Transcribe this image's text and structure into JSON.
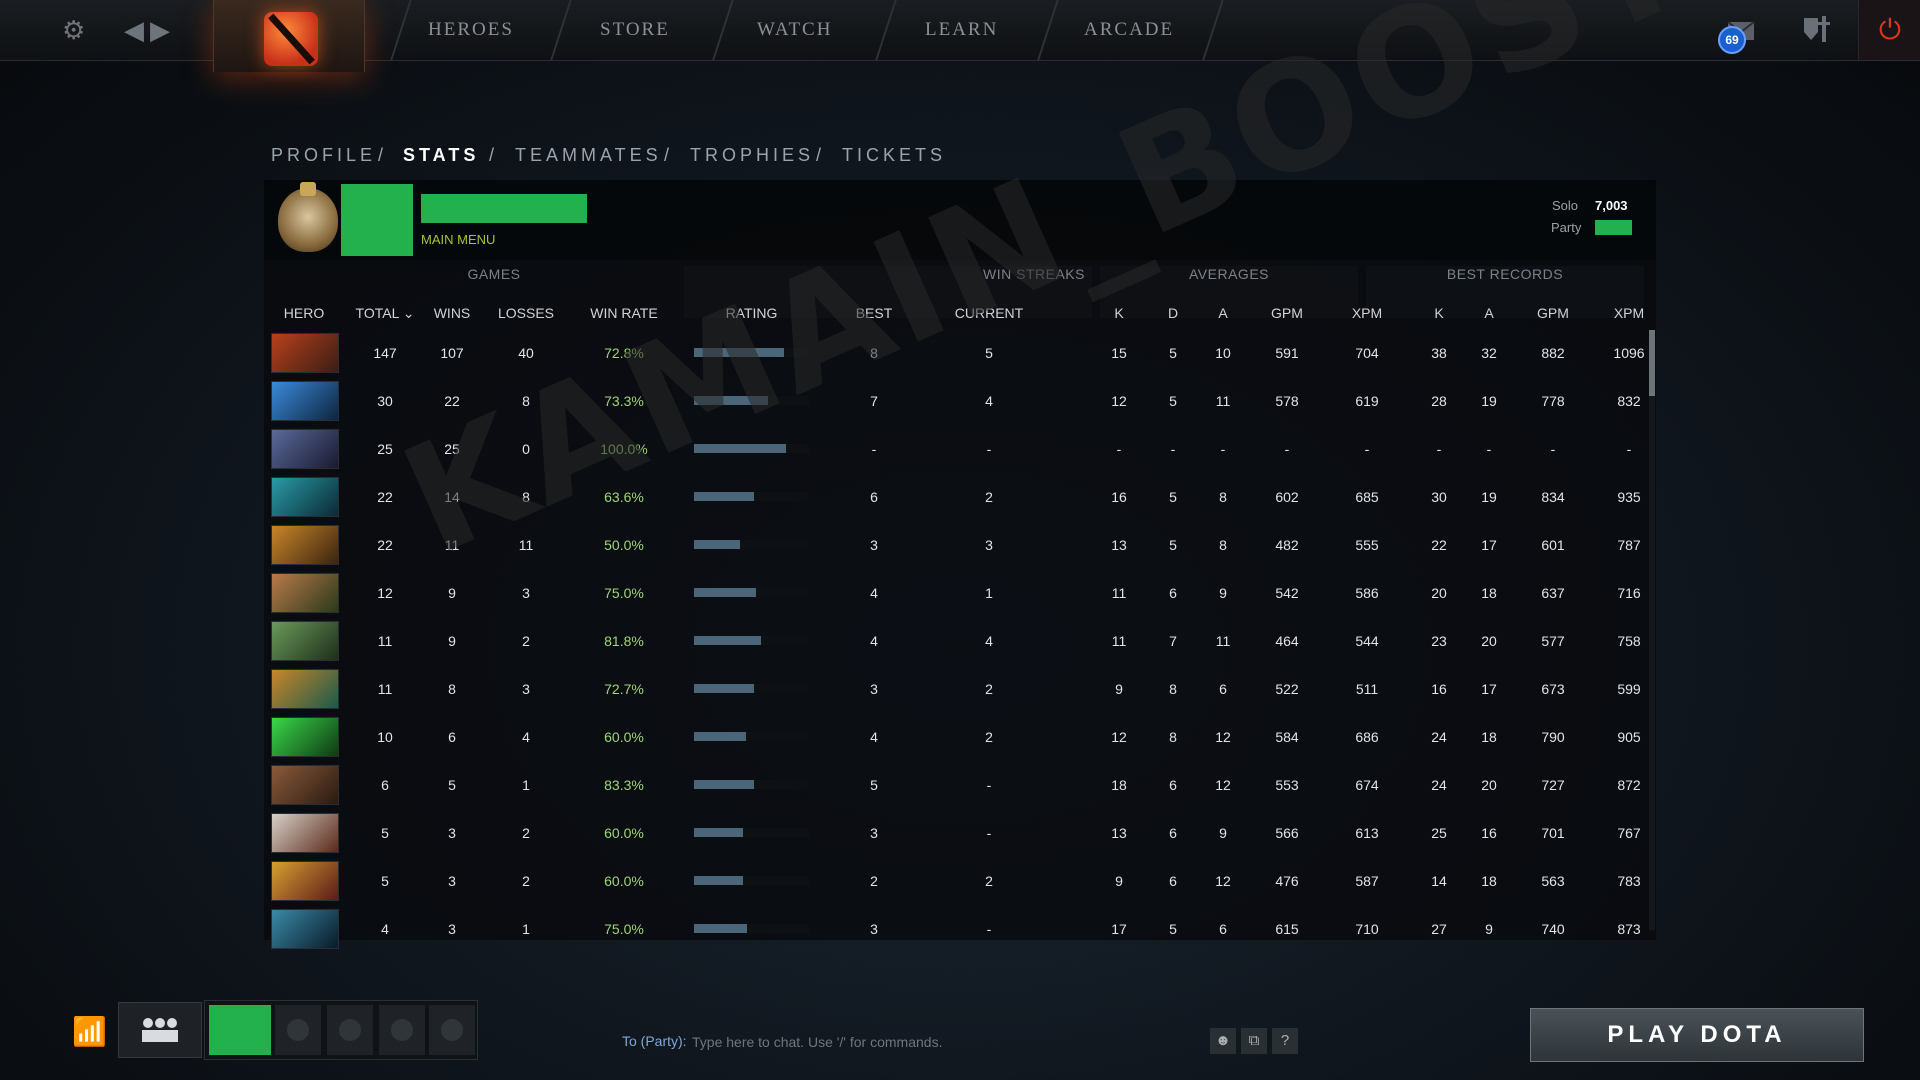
{
  "topbar": {
    "nav": [
      "HEROES",
      "STORE",
      "WATCH",
      "LEARN",
      "ARCADE"
    ],
    "notification_count": "69"
  },
  "profile_tabs": [
    "PROFILE",
    "STATS",
    "TEAMMATES",
    "TROPHIES",
    "TICKETS"
  ],
  "header": {
    "status": "MAIN MENU",
    "solo_label": "Solo",
    "solo_value": "7,003",
    "party_label": "Party"
  },
  "groups": {
    "games": "GAMES",
    "win_streaks": "WIN STREAKS",
    "averages": "AVERAGES",
    "best_records": "BEST RECORDS"
  },
  "columns": {
    "hero": "HERO",
    "total": "TOTAL ⌄",
    "wins": "WINS",
    "losses": "LOSSES",
    "win_rate": "WIN RATE",
    "rating": "RATING",
    "best": "BEST",
    "current": "CURRENT",
    "avg_k": "K",
    "avg_d": "D",
    "avg_a": "A",
    "avg_gpm": "GPM",
    "avg_xpm": "XPM",
    "best_k": "K",
    "best_a": "A",
    "best_gpm": "GPM",
    "best_xpm": "XPM"
  },
  "rows": [
    {
      "colors": [
        "#b8401c",
        "#3a1e14"
      ],
      "total": "147",
      "wins": "107",
      "losses": "40",
      "win_rate": "72.8%",
      "rating": 0.78,
      "best": "8",
      "current": "5",
      "k": "15",
      "d": "5",
      "a": "10",
      "gpm": "591",
      "xpm": "704",
      "bk": "38",
      "ba": "32",
      "bgpm": "882",
      "bxpm": "1096"
    },
    {
      "colors": [
        "#3a8ad8",
        "#0e2440"
      ],
      "total": "30",
      "wins": "22",
      "losses": "8",
      "win_rate": "73.3%",
      "rating": 0.64,
      "best": "7",
      "current": "4",
      "k": "12",
      "d": "5",
      "a": "11",
      "gpm": "578",
      "xpm": "619",
      "bk": "28",
      "ba": "19",
      "bgpm": "778",
      "bxpm": "832"
    },
    {
      "colors": [
        "#5a6a9a",
        "#1a1a30"
      ],
      "total": "25",
      "wins": "25",
      "losses": "0",
      "win_rate": "100.0%",
      "rating": 0.8,
      "best": "-",
      "current": "-",
      "k": "-",
      "d": "-",
      "a": "-",
      "gpm": "-",
      "xpm": "-",
      "bk": "-",
      "ba": "-",
      "bgpm": "-",
      "bxpm": "-"
    },
    {
      "colors": [
        "#2a9aa8",
        "#0a2a34"
      ],
      "total": "22",
      "wins": "14",
      "losses": "8",
      "win_rate": "63.6%",
      "rating": 0.52,
      "best": "6",
      "current": "2",
      "k": "16",
      "d": "5",
      "a": "8",
      "gpm": "602",
      "xpm": "685",
      "bk": "30",
      "ba": "19",
      "bgpm": "834",
      "bxpm": "935"
    },
    {
      "colors": [
        "#c8862a",
        "#3a2410"
      ],
      "total": "22",
      "wins": "11",
      "losses": "11",
      "win_rate": "50.0%",
      "rating": 0.4,
      "best": "3",
      "current": "3",
      "k": "13",
      "d": "5",
      "a": "8",
      "gpm": "482",
      "xpm": "555",
      "bk": "22",
      "ba": "17",
      "bgpm": "601",
      "bxpm": "787"
    },
    {
      "colors": [
        "#b87a4a",
        "#2a3a1a"
      ],
      "total": "12",
      "wins": "9",
      "losses": "3",
      "win_rate": "75.0%",
      "rating": 0.54,
      "best": "4",
      "current": "1",
      "k": "11",
      "d": "6",
      "a": "9",
      "gpm": "542",
      "xpm": "586",
      "bk": "20",
      "ba": "18",
      "bgpm": "637",
      "bxpm": "716"
    },
    {
      "colors": [
        "#6a9a5a",
        "#1e2e1a"
      ],
      "total": "11",
      "wins": "9",
      "losses": "2",
      "win_rate": "81.8%",
      "rating": 0.58,
      "best": "4",
      "current": "4",
      "k": "11",
      "d": "7",
      "a": "11",
      "gpm": "464",
      "xpm": "544",
      "bk": "23",
      "ba": "20",
      "bgpm": "577",
      "bxpm": "758"
    },
    {
      "colors": [
        "#c8862a",
        "#1a5a4a"
      ],
      "total": "11",
      "wins": "8",
      "losses": "3",
      "win_rate": "72.7%",
      "rating": 0.52,
      "best": "3",
      "current": "2",
      "k": "9",
      "d": "8",
      "a": "6",
      "gpm": "522",
      "xpm": "511",
      "bk": "16",
      "ba": "17",
      "bgpm": "673",
      "bxpm": "599"
    },
    {
      "colors": [
        "#3ad84a",
        "#0e3a14"
      ],
      "total": "10",
      "wins": "6",
      "losses": "4",
      "win_rate": "60.0%",
      "rating": 0.45,
      "best": "4",
      "current": "2",
      "k": "12",
      "d": "8",
      "a": "12",
      "gpm": "584",
      "xpm": "686",
      "bk": "24",
      "ba": "18",
      "bgpm": "790",
      "bxpm": "905"
    },
    {
      "colors": [
        "#8a5a3a",
        "#2a1a10"
      ],
      "total": "6",
      "wins": "5",
      "losses": "1",
      "win_rate": "83.3%",
      "rating": 0.52,
      "best": "5",
      "current": "-",
      "k": "18",
      "d": "6",
      "a": "12",
      "gpm": "553",
      "xpm": "674",
      "bk": "24",
      "ba": "20",
      "bgpm": "727",
      "bxpm": "872"
    },
    {
      "colors": [
        "#d8d0c8",
        "#5a2a1a"
      ],
      "total": "5",
      "wins": "3",
      "losses": "2",
      "win_rate": "60.0%",
      "rating": 0.43,
      "best": "3",
      "current": "-",
      "k": "13",
      "d": "6",
      "a": "9",
      "gpm": "566",
      "xpm": "613",
      "bk": "25",
      "ba": "16",
      "bgpm": "701",
      "bxpm": "767"
    },
    {
      "colors": [
        "#d8a030",
        "#5a1a1a"
      ],
      "total": "5",
      "wins": "3",
      "losses": "2",
      "win_rate": "60.0%",
      "rating": 0.43,
      "best": "2",
      "current": "2",
      "k": "9",
      "d": "6",
      "a": "12",
      "gpm": "476",
      "xpm": "587",
      "bk": "14",
      "ba": "18",
      "bgpm": "563",
      "bxpm": "783"
    },
    {
      "colors": [
        "#3a8aa8",
        "#0a1a28"
      ],
      "total": "4",
      "wins": "3",
      "losses": "1",
      "win_rate": "75.0%",
      "rating": 0.46,
      "best": "3",
      "current": "-",
      "k": "17",
      "d": "5",
      "a": "6",
      "gpm": "615",
      "xpm": "710",
      "bk": "27",
      "ba": "9",
      "bgpm": "740",
      "bxpm": "873"
    }
  ],
  "watermark": "KAMAIN_BOOST",
  "bottom": {
    "chat_label": "To (Party):",
    "chat_placeholder": "Type here to chat. Use '/' for commands.",
    "help": "?",
    "play": "PLAY DOTA"
  }
}
